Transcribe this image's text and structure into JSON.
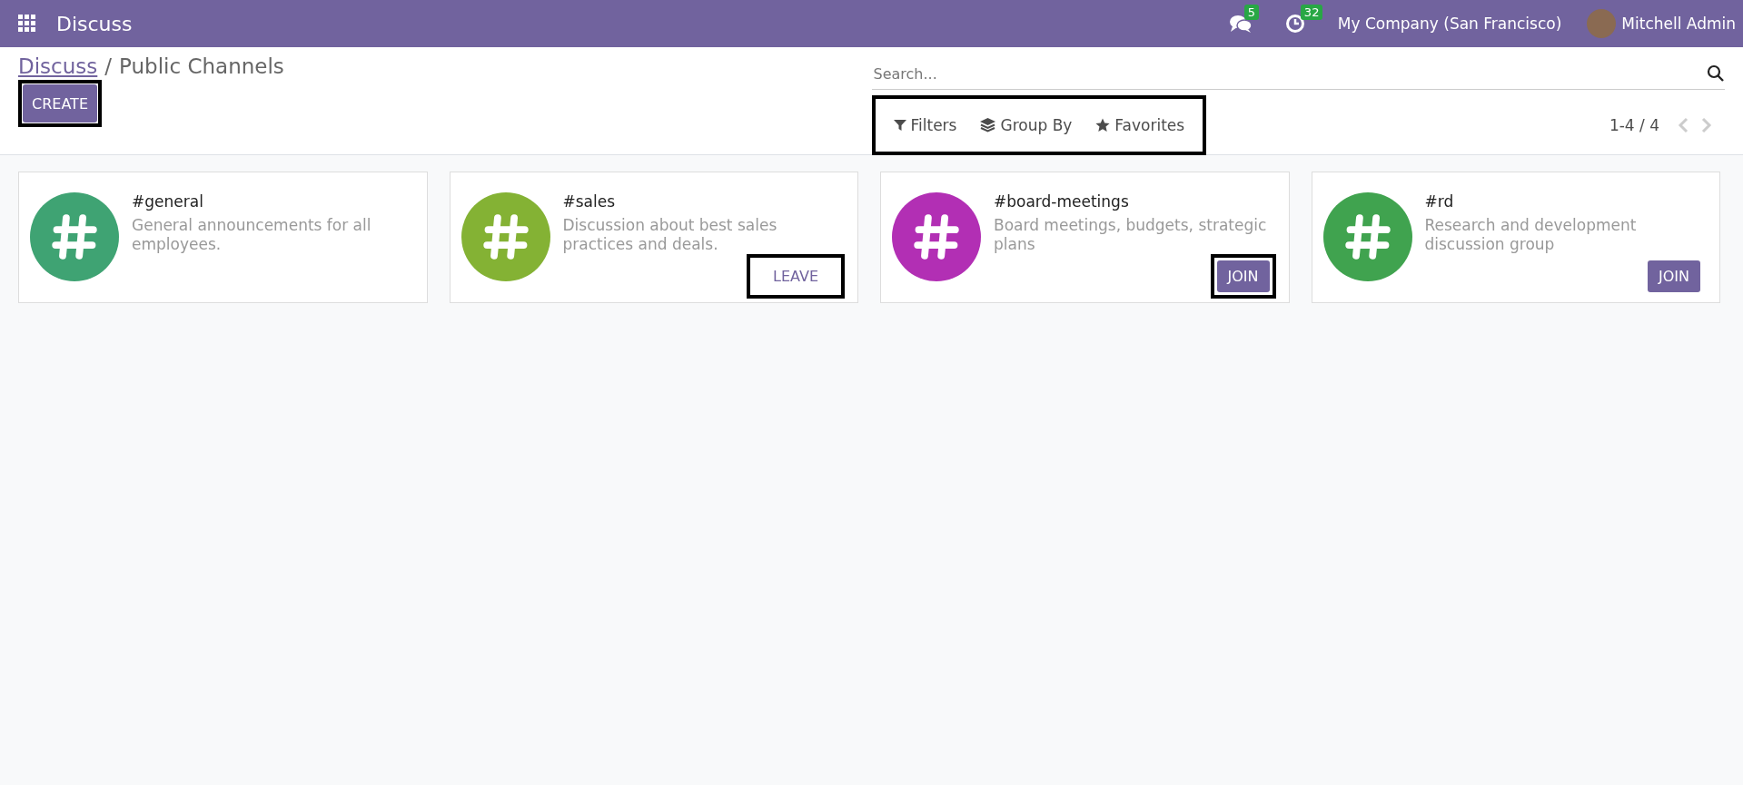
{
  "navbar": {
    "app_title": "Discuss",
    "messages_badge": "5",
    "activities_badge": "32",
    "company": "My Company (San Francisco)",
    "user": "Mitchell Admin"
  },
  "control_panel": {
    "breadcrumb": [
      {
        "label": "Discuss",
        "kind": "link"
      },
      {
        "label": "/",
        "kind": "separator"
      },
      {
        "label": "Public Channels",
        "kind": "current"
      }
    ],
    "create_button": {
      "label": "CREATE",
      "highlighted": true
    },
    "search": {
      "placeholder": "Search..."
    },
    "search_options": {
      "highlighted": true,
      "items": [
        {
          "label": "Filters",
          "kind": "filter"
        },
        {
          "label": "Group By",
          "kind": "layers"
        },
        {
          "label": "Favorites",
          "kind": "star"
        }
      ]
    },
    "pager": "1-4 / 4"
  },
  "channels": [
    {
      "name": "#general",
      "description": "General announcements for all employees.",
      "color": "#3fa373"
    },
    {
      "name": "#sales",
      "description": "Discussion about best sales practices and deals.",
      "color": "#84b234",
      "button": {
        "label": "LEAVE",
        "kind": "leave",
        "highlighted": true
      }
    },
    {
      "name": "#board-meetings",
      "description": "Board meetings, budgets, strategic plans",
      "color": "#b22fb4",
      "button": {
        "label": "JOIN",
        "kind": "join",
        "highlighted": true
      }
    },
    {
      "name": "#rd",
      "description": "Research and development discussion group",
      "color": "#40a34f",
      "button": {
        "label": "JOIN",
        "kind": "join",
        "highlighted": false
      }
    }
  ]
}
